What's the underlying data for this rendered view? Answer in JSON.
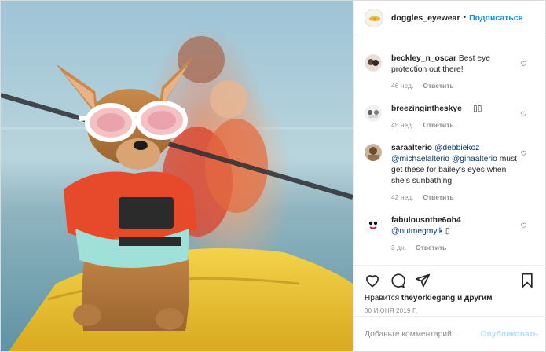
{
  "header": {
    "username": "doggles_eyewear",
    "separator": "•",
    "follow_label": "Подписаться"
  },
  "comments": [
    {
      "user": "beckley_n_oscar",
      "text_segments": [
        {
          "t": "Best eye protection out there!",
          "m": false
        }
      ],
      "time": "46 нед.",
      "reply": "Ответить"
    },
    {
      "user": "breezingintheskye__",
      "text_segments": [
        {
          "t": "▯▯",
          "m": false
        }
      ],
      "time": "45 нед.",
      "reply": "Ответить"
    },
    {
      "user": "saraalterio",
      "text_segments": [
        {
          "t": "@debbiekoz",
          "m": true
        },
        {
          "t": " ",
          "m": false
        },
        {
          "t": "@michaelalterio",
          "m": true
        },
        {
          "t": " ",
          "m": false
        },
        {
          "t": "@ginaalterio",
          "m": true
        },
        {
          "t": " must get these for bailey’s eyes when she’s sunbathing",
          "m": false
        }
      ],
      "time": "42 нед.",
      "reply": "Ответить"
    },
    {
      "user": "fabulousnthe6oh4",
      "text_segments": [
        {
          "t": "@nutmegmylk",
          "m": true
        },
        {
          "t": " ▯",
          "m": false
        }
      ],
      "time": "3 дн.",
      "reply": "Ответить"
    }
  ],
  "actions": {
    "icons": [
      "heart-icon",
      "comment-icon",
      "share-icon",
      "bookmark-icon"
    ],
    "likes_prefix": "Нравится",
    "likes_user": "theyorkiegang",
    "likes_suffix": "и другим",
    "date": "30 ИЮНЯ 2019 Г."
  },
  "add_comment": {
    "placeholder": "Добавьте комментарий...",
    "publish_label": "Опубликовать"
  },
  "colors": {
    "link_blue": "#0095f6",
    "mention": "#00376b",
    "muted": "#8e8e8e",
    "publish_disabled": "#b2dffc"
  }
}
